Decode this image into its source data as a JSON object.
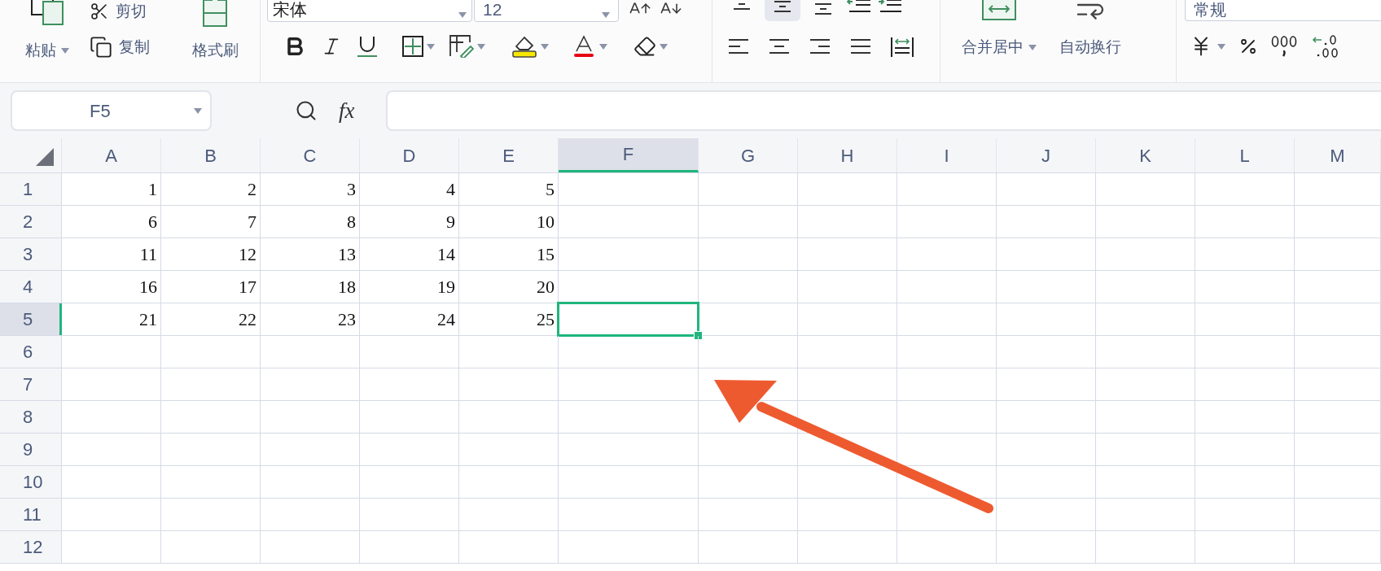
{
  "ribbon": {
    "clipboard": {
      "paste": "粘贴",
      "cut": "剪切",
      "copy": "复制",
      "format_painter": "格式刷"
    },
    "font": {
      "name": "宋体",
      "size": "12"
    },
    "vertical_align": [
      {
        "kind": "top",
        "selected": false
      },
      {
        "kind": "middle",
        "selected": true
      },
      {
        "kind": "bottom",
        "selected": false
      }
    ],
    "merge": "合并居中",
    "wrap": "自动换行",
    "number_format": "常规"
  },
  "formula_bar": {
    "name_box": "F5",
    "formula_label": "fx"
  },
  "sheet": {
    "columns": [
      {
        "label": "A",
        "selected": false
      },
      {
        "label": "B",
        "selected": false
      },
      {
        "label": "C",
        "selected": false
      },
      {
        "label": "D",
        "selected": false
      },
      {
        "label": "E",
        "selected": false
      },
      {
        "label": "F",
        "selected": true
      },
      {
        "label": "G",
        "selected": false
      },
      {
        "label": "H",
        "selected": false
      },
      {
        "label": "I",
        "selected": false
      },
      {
        "label": "J",
        "selected": false
      },
      {
        "label": "K",
        "selected": false
      },
      {
        "label": "L",
        "selected": false
      },
      {
        "label": "M",
        "selected": false
      }
    ],
    "rows": [
      {
        "label": "1",
        "selected": false,
        "cells": [
          "1",
          "2",
          "3",
          "4",
          "5"
        ]
      },
      {
        "label": "2",
        "selected": false,
        "cells": [
          "6",
          "7",
          "8",
          "9",
          "10"
        ]
      },
      {
        "label": "3",
        "selected": false,
        "cells": [
          "11",
          "12",
          "13",
          "14",
          "15"
        ]
      },
      {
        "label": "4",
        "selected": false,
        "cells": [
          "16",
          "17",
          "18",
          "19",
          "20"
        ]
      },
      {
        "label": "5",
        "selected": true,
        "cells": [
          "21",
          "22",
          "23",
          "24",
          "25"
        ]
      },
      {
        "label": "6",
        "selected": false
      },
      {
        "label": "7",
        "selected": false
      },
      {
        "label": "8",
        "selected": false
      },
      {
        "label": "9",
        "selected": false
      },
      {
        "label": "10",
        "selected": false
      },
      {
        "label": "11",
        "selected": false
      },
      {
        "label": "12",
        "selected": false
      }
    ]
  },
  "annotation": {
    "kind": "arrow"
  }
}
